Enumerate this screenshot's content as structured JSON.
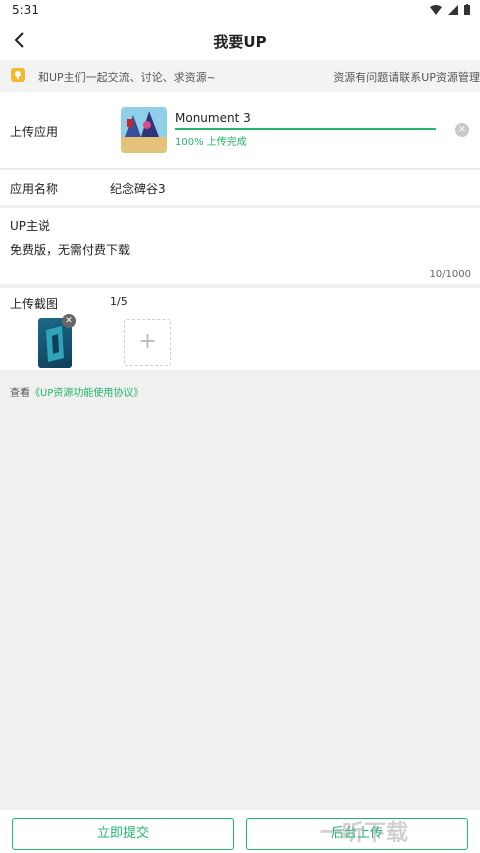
{
  "status": {
    "time": "5:31"
  },
  "header": {
    "title": "我要UP"
  },
  "notice": {
    "left_text": "和UP主们一起交流、讨论、求资源~",
    "right_text": "资源有问题请联系UP资源管理"
  },
  "upload": {
    "label": "上传应用",
    "app_name": "Monument 3",
    "progress_value": 1.0,
    "progress_text": "100% 上传完成",
    "accent_color": "#22b76a"
  },
  "app_name_row": {
    "label": "应用名称",
    "value": "纪念碑谷3"
  },
  "description": {
    "label": "UP主说",
    "text": "免费版，无需付费下载",
    "counter": "10/1000"
  },
  "screenshots": {
    "label": "上传截图",
    "count": "1/5",
    "add_symbol": "+"
  },
  "agreement": {
    "prefix": "查看",
    "link": "《UP资源功能使用协议》"
  },
  "footer": {
    "submit_label": "立即提交",
    "background_upload_label": "后台上传"
  },
  "watermark": "一听下载"
}
